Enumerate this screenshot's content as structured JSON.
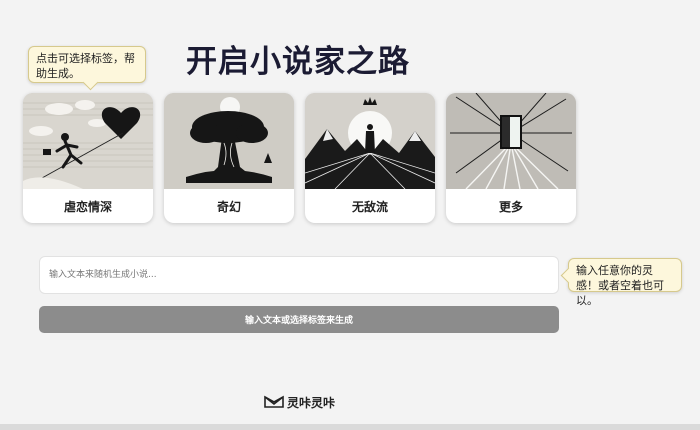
{
  "title": "开启小说家之路",
  "tooltips": {
    "tags": "点击可选择标签，帮助生成。",
    "input": "输入任意你的灵感！或者空着也可以。"
  },
  "cards": [
    {
      "label": "虐恋情深",
      "icon": "heartbreak-runner-image"
    },
    {
      "label": "奇幻",
      "icon": "fantasy-tree-image"
    },
    {
      "label": "无敌流",
      "icon": "crowned-king-mountain-image"
    },
    {
      "label": "更多",
      "icon": "glowing-door-image"
    }
  ],
  "input": {
    "placeholder": "输入文本来随机生成小说...",
    "value": ""
  },
  "generate_button": "输入文本或选择标签来生成",
  "footer": {
    "brand": "灵咔灵咔"
  },
  "colors": {
    "title": "#1b1b33",
    "button": "#8c8c8c",
    "tooltip_bg": "#fdf7dc"
  }
}
